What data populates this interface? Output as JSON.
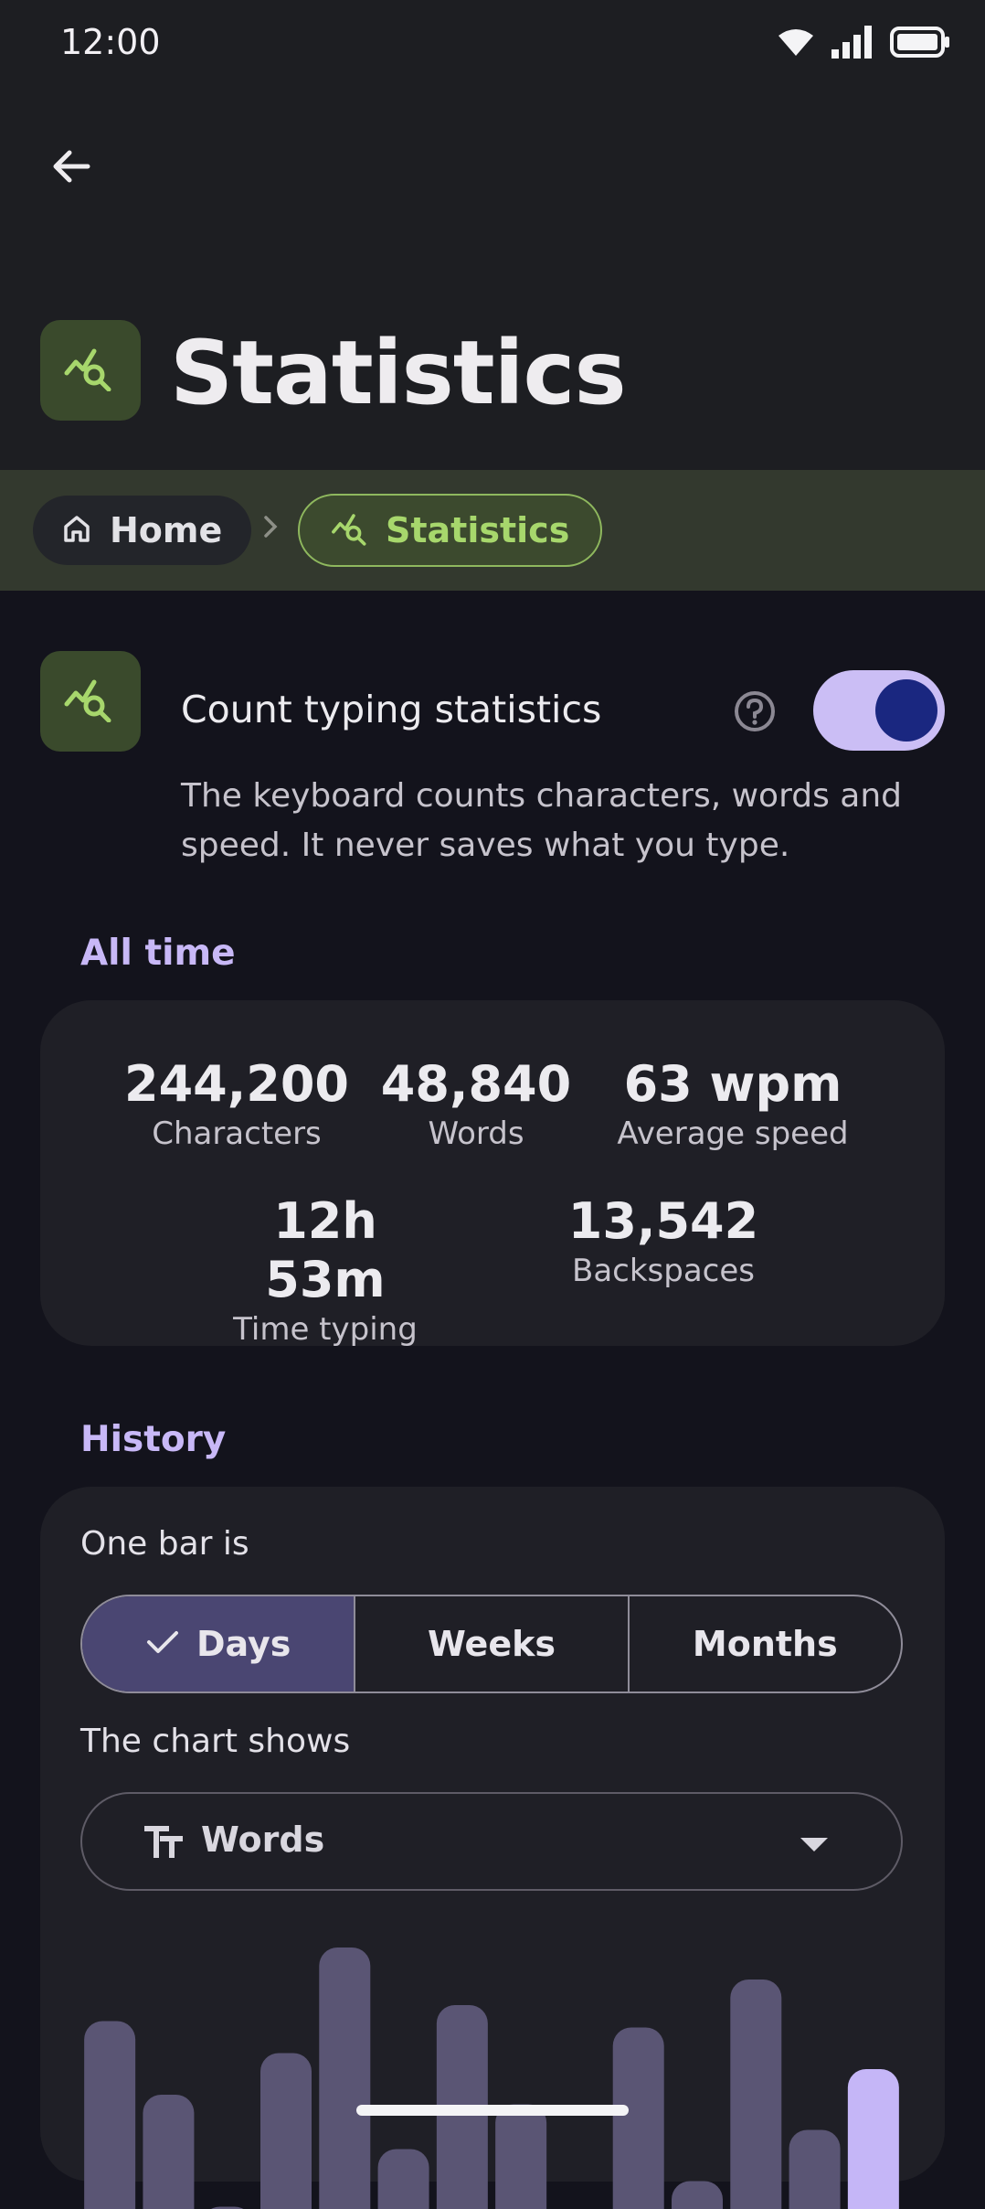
{
  "status_bar": {
    "time": "12:00",
    "icons": [
      "wifi-icon",
      "signal-icon",
      "battery-icon"
    ]
  },
  "header": {
    "back_icon": "arrow-left-icon",
    "title": "Statistics",
    "icon": "chart-search-icon"
  },
  "breadcrumb": {
    "items": [
      {
        "label": "Home",
        "icon": "home-icon"
      },
      {
        "label": "Statistics",
        "icon": "chart-search-icon",
        "active": true
      }
    ]
  },
  "setting": {
    "title": "Count typing statistics",
    "description": "The keyboard counts characters, words and speed. It never saves what you type.",
    "enabled": true,
    "help_icon": "help-circle-icon"
  },
  "all_time": {
    "label": "All time",
    "stats": [
      {
        "value": "244,200",
        "label": "Characters"
      },
      {
        "value": "48,840",
        "label": "Words"
      },
      {
        "value": "63 wpm",
        "label": "Average speed"
      },
      {
        "value": "12h 53m",
        "label": "Time typing"
      },
      {
        "value": "13,542",
        "label": "Backspaces"
      }
    ]
  },
  "history": {
    "label": "History",
    "bar_label": "One bar is",
    "periods": [
      {
        "label": "Days",
        "selected": true
      },
      {
        "label": "Weeks",
        "selected": false
      },
      {
        "label": "Months",
        "selected": false
      }
    ],
    "chart_label": "The chart shows",
    "metric": {
      "value": "Words",
      "icon": "text-size-icon"
    }
  },
  "chart_data": {
    "type": "bar",
    "values": [
      0.73,
      0.5,
      0.15,
      0.63,
      0.96,
      0.33,
      0.78,
      0.47,
      0,
      0.71,
      0.23,
      0.86,
      0.39,
      0.58
    ],
    "highlight_index": 13,
    "colors": {
      "bar": "#5a5574",
      "highlight": "#c5b6f7"
    }
  },
  "colors": {
    "accent": "#c8b8f7",
    "green": "#a7d76c",
    "background": "#13131c"
  }
}
